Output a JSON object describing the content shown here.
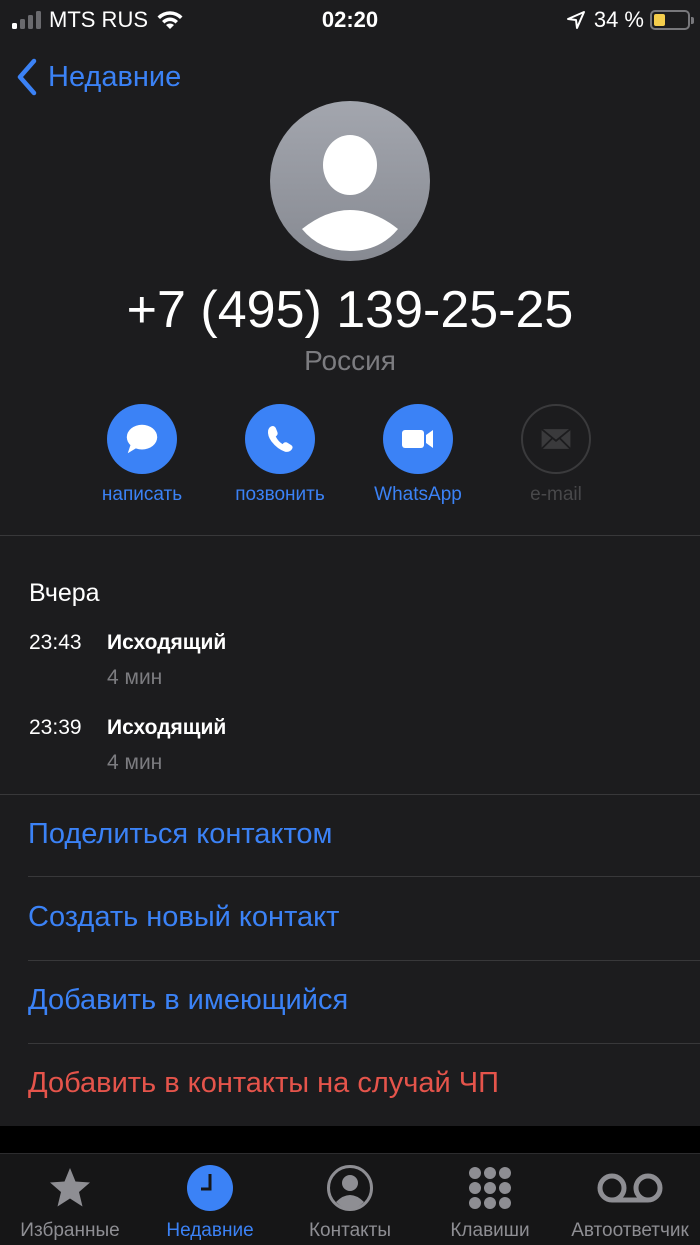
{
  "status_bar": {
    "carrier": "MTS RUS",
    "signal_bars_active": 1,
    "signal_bars_total": 4,
    "time": "02:20",
    "battery_percent_text": "34 %",
    "battery_level": 0.34,
    "battery_color": "#f4cd4c",
    "icons": [
      "signal-icon",
      "wifi-icon",
      "location-arrow-icon",
      "battery-icon"
    ]
  },
  "nav": {
    "back_label": "Недавние",
    "back_icon": "chevron-left-icon"
  },
  "contact": {
    "avatar_icon": "person-placeholder-icon",
    "phone_number": "+7 (495) 139-25-25",
    "country": "Россия"
  },
  "actions": [
    {
      "label": "написать",
      "icon": "message-bubble-icon",
      "enabled": true
    },
    {
      "label": "позвонить",
      "icon": "phone-icon",
      "enabled": true
    },
    {
      "label": "WhatsApp",
      "icon": "video-camera-icon",
      "enabled": true
    },
    {
      "label": "e-mail",
      "icon": "envelope-icon",
      "enabled": false
    }
  ],
  "calls": {
    "day": "Вчера",
    "items": [
      {
        "time": "23:43",
        "type": "Исходящий",
        "duration": "4 мин"
      },
      {
        "time": "23:39",
        "type": "Исходящий",
        "duration": "4 мин"
      }
    ]
  },
  "menu": [
    {
      "label": "Поделиться контактом",
      "style": "normal"
    },
    {
      "label": "Создать новый контакт",
      "style": "normal"
    },
    {
      "label": "Добавить в имеющийся",
      "style": "normal"
    },
    {
      "label": "Добавить в контакты на случай ЧП",
      "style": "danger"
    }
  ],
  "tabbar": {
    "active_index": 1,
    "items": [
      {
        "label": "Избранные",
        "icon": "star-icon"
      },
      {
        "label": "Недавние",
        "icon": "clock-icon"
      },
      {
        "label": "Контакты",
        "icon": "person-circle-icon"
      },
      {
        "label": "Клавиши",
        "icon": "keypad-icon"
      },
      {
        "label": "Автоответчик",
        "icon": "voicemail-icon"
      }
    ]
  },
  "colors": {
    "accent": "#3b82f6",
    "danger": "#e5544b",
    "background": "#1c1c1e",
    "secondary_text": "#7c7c80"
  }
}
